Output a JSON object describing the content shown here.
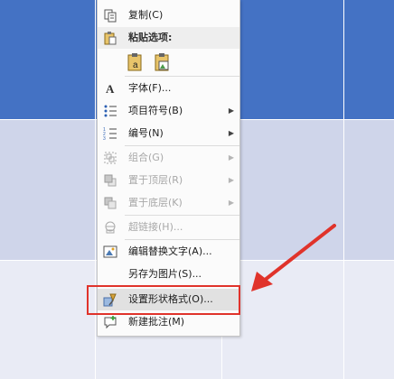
{
  "menu": {
    "items": [
      {
        "label": "复制(C)",
        "icon": "copy-icon",
        "enabled": true
      },
      {
        "label": "粘贴选项:",
        "icon": "paste-icon",
        "header": true
      },
      {
        "label": "字体(F)...",
        "icon": "font-icon",
        "enabled": true
      },
      {
        "label": "项目符号(B)",
        "icon": "bullets-icon",
        "enabled": true,
        "submenu": true
      },
      {
        "label": "编号(N)",
        "icon": "numbering-icon",
        "enabled": true,
        "submenu": true
      },
      {
        "label": "组合(G)",
        "icon": "group-icon",
        "enabled": false,
        "submenu": true
      },
      {
        "label": "置于顶层(R)",
        "icon": "bring-to-front-icon",
        "enabled": false,
        "submenu": true
      },
      {
        "label": "置于底层(K)",
        "icon": "send-to-back-icon",
        "enabled": false,
        "submenu": true
      },
      {
        "label": "超链接(H)...",
        "icon": "hyperlink-icon",
        "enabled": false
      },
      {
        "label": "编辑替换文字(A)...",
        "icon": "alt-text-icon",
        "enabled": true
      },
      {
        "label": "另存为图片(S)...",
        "icon": "",
        "enabled": true
      },
      {
        "label": "设置形状格式(O)...",
        "icon": "format-shape-icon",
        "enabled": true,
        "highlighted": true
      },
      {
        "label": "新建批注(M)",
        "icon": "new-comment-icon",
        "enabled": true
      }
    ],
    "paste_options": [
      "paste-keep-text-icon",
      "paste-picture-icon"
    ],
    "submenu_arrow": "▶"
  },
  "colors": {
    "table_header": "#4472c4",
    "table_band_1": "#cfd5ea",
    "table_band_2": "#e9ebf5",
    "annotation_red": "#e0332b"
  }
}
